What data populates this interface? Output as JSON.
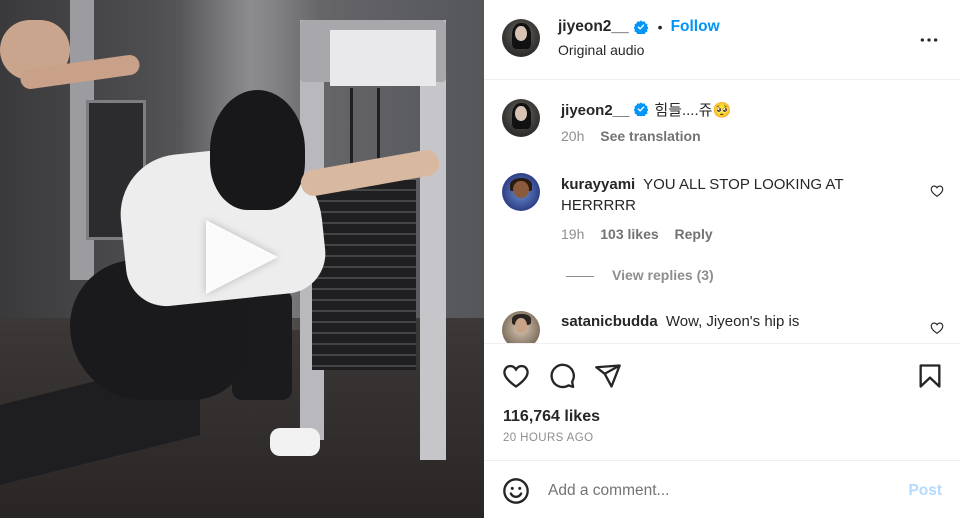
{
  "post": {
    "author": "jiyeon2__",
    "verified": true,
    "follow_label": "Follow",
    "separator": "•",
    "audio": "Original audio"
  },
  "comments": [
    {
      "username": "jiyeon2__",
      "verified": true,
      "text": "힘들....쥬🥺",
      "time": "20h",
      "action": "See translation"
    },
    {
      "username": "kurayyami",
      "text": "YOU ALL STOP LOOKING AT HERRRRR",
      "time": "19h",
      "likes": "103 likes",
      "reply": "Reply",
      "view_replies": "View replies (3)"
    },
    {
      "username": "satanicbudda",
      "text": "Wow, Jiyeon's hip is"
    }
  ],
  "stats": {
    "likes": "116,764 likes",
    "time_ago": "20 HOURS AGO"
  },
  "composer": {
    "placeholder": "Add a comment...",
    "post_label": "Post"
  },
  "icons": {
    "play": "play-icon",
    "verified": "verified-badge-icon",
    "more": "more-options-icon",
    "heart": "heart-icon",
    "comment": "comment-icon",
    "share": "share-icon",
    "save": "bookmark-icon",
    "emoji": "emoji-icon"
  },
  "colors": {
    "accent": "#0095f6",
    "post_disabled": "#b3dbff",
    "muted": "#8e8e8e",
    "text": "#262626"
  }
}
